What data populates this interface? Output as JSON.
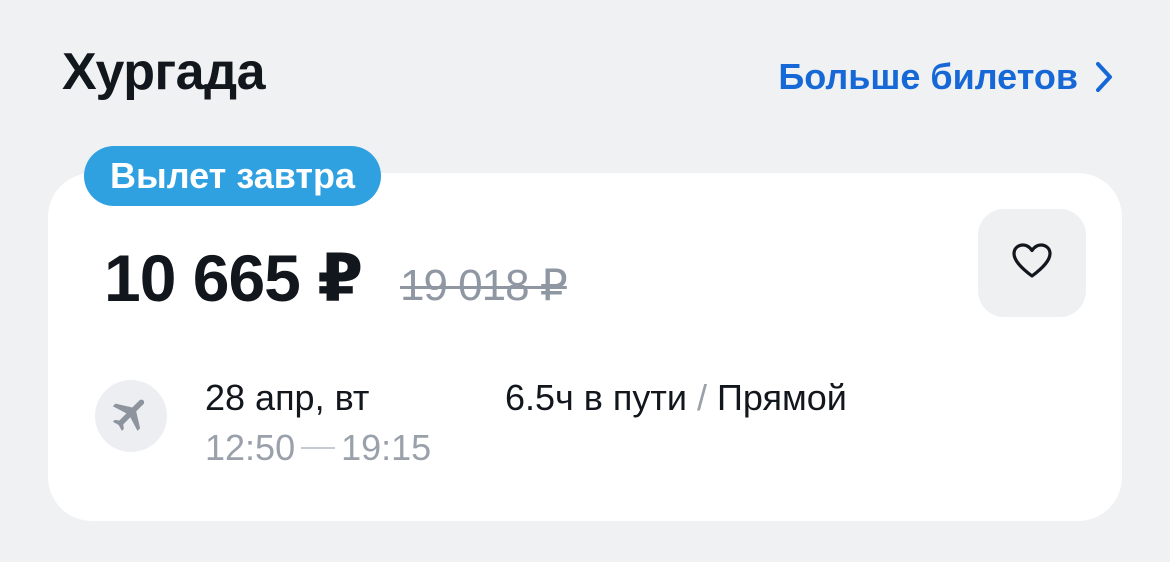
{
  "header": {
    "title": "Хургада",
    "more_link": "Больше билетов"
  },
  "offer": {
    "badge": "Вылет завтра",
    "price": "10 665 ₽",
    "old_price": "19 018 ₽",
    "date": "28 апр, вт",
    "departure_time": "12:50",
    "arrival_time": "19:15",
    "duration": "6.5ч в пути",
    "separator": "/",
    "flight_type": "Прямой"
  },
  "icons": {
    "more": "chevron-right-icon",
    "favorite": "heart-outline-icon",
    "flight": "airplane-icon"
  },
  "colors": {
    "accent_link": "#1668d6",
    "badge_bg": "#2fa0e0",
    "background": "#f0f1f3",
    "card": "#ffffff"
  }
}
